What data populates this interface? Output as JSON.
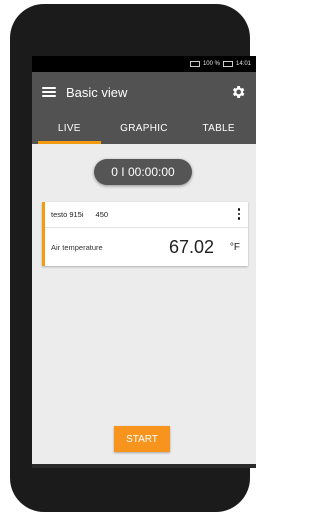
{
  "status_bar": {
    "battery_text": "100 %",
    "time": "14:01"
  },
  "header": {
    "title": "Basic view",
    "menu_icon": "hamburger-icon",
    "settings_icon": "gear-icon"
  },
  "tabs": [
    {
      "label": "LIVE",
      "active": true
    },
    {
      "label": "GRAPHIC",
      "active": false
    },
    {
      "label": "TABLE",
      "active": false
    }
  ],
  "timer": {
    "text": "0 I 00:00:00"
  },
  "measurement_card": {
    "device": "testo 915i",
    "serial": "450",
    "parameter": "Air temperature",
    "value": "67.02",
    "unit": "°F",
    "accent": "#f39c12"
  },
  "start_button": {
    "label": "START",
    "color": "#f7941d"
  }
}
